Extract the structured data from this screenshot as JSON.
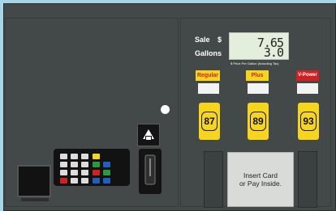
{
  "display": {
    "sale_label": "Sale",
    "currency": "$",
    "gallons_label": "Gallons",
    "sale_value": "7.65",
    "gallons_value": "3.0",
    "price_per_gallon_caption": "$ Price Per Gallon (Including Tax)"
  },
  "grades": [
    {
      "name": "Regular",
      "octane": "87",
      "label_bg": "#f7d51d",
      "label_color": "#d21f1f"
    },
    {
      "name": "Plus",
      "octane": "89",
      "label_bg": "#f7d51d",
      "label_color": "#d21f1f"
    },
    {
      "name": "V-Power",
      "octane": "93",
      "label_bg": "#d21f1f",
      "label_color": "#ffffff"
    }
  ],
  "insert_card": {
    "line1": "Insert Card",
    "line2": "or Pay Inside."
  },
  "colors": {
    "pump_body": "#434848",
    "display_bg": "#e4eedd",
    "octane_yellow": "#f7d51d"
  }
}
